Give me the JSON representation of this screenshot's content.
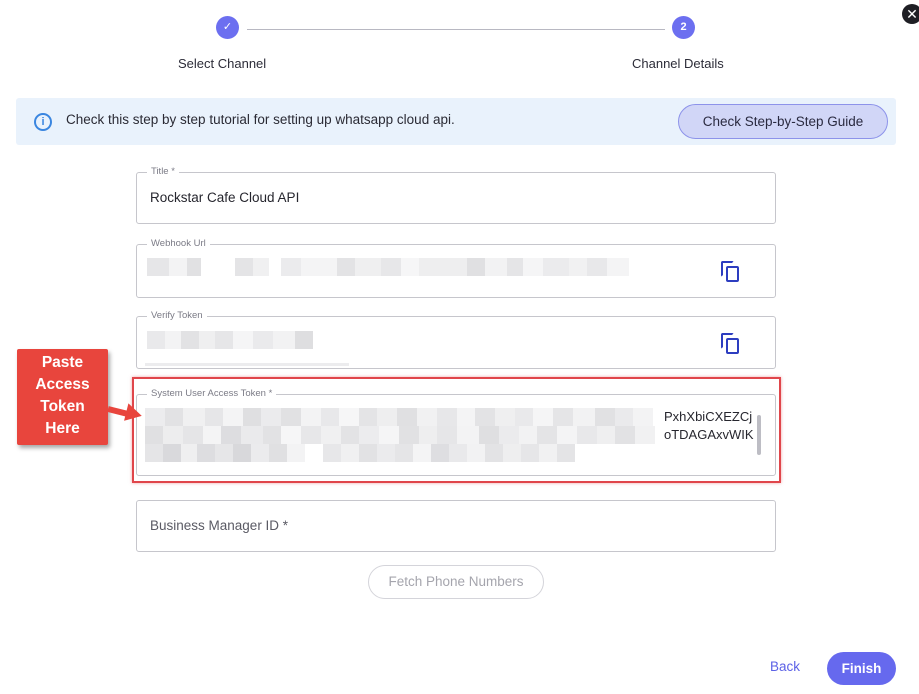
{
  "dialog": {
    "close_glyph": "✕"
  },
  "stepper": {
    "steps": [
      {
        "label": "Select Channel",
        "glyph": "✓"
      },
      {
        "label": "Channel Details",
        "glyph": "2"
      }
    ]
  },
  "banner": {
    "icon_glyph": "i",
    "text": "Check this step by step tutorial for setting up whatsapp cloud api.",
    "button_label": "Check Step-by-Step Guide"
  },
  "fields": {
    "title": {
      "label": "Title *",
      "value": "Rockstar Cafe Cloud API"
    },
    "webhook": {
      "label": "Webhook Url"
    },
    "verify": {
      "label": "Verify Token"
    },
    "token": {
      "label": "System User Access Token *",
      "visible_tail_line1": "PxhXbiCXEZCj",
      "visible_tail_line2": "oTDAGAxvWIK"
    },
    "business": {
      "placeholder": "Business Manager ID *"
    }
  },
  "callout": {
    "lines": [
      "Paste",
      "Access",
      "Token",
      "Here"
    ]
  },
  "buttons": {
    "fetch": "Fetch Phone Numbers",
    "back": "Back",
    "finish": "Finish"
  },
  "colors": {
    "accent": "#6669ee",
    "highlight": "#e0464b",
    "callout": "#e8453d",
    "banner_bg": "#e9f2fc",
    "copy_icon": "#2d3dc0"
  },
  "icons": {
    "close": "close-icon",
    "step_done": "check-icon",
    "info": "info-icon",
    "copy": "copy-icon",
    "arrow": "arrow-right-icon"
  }
}
